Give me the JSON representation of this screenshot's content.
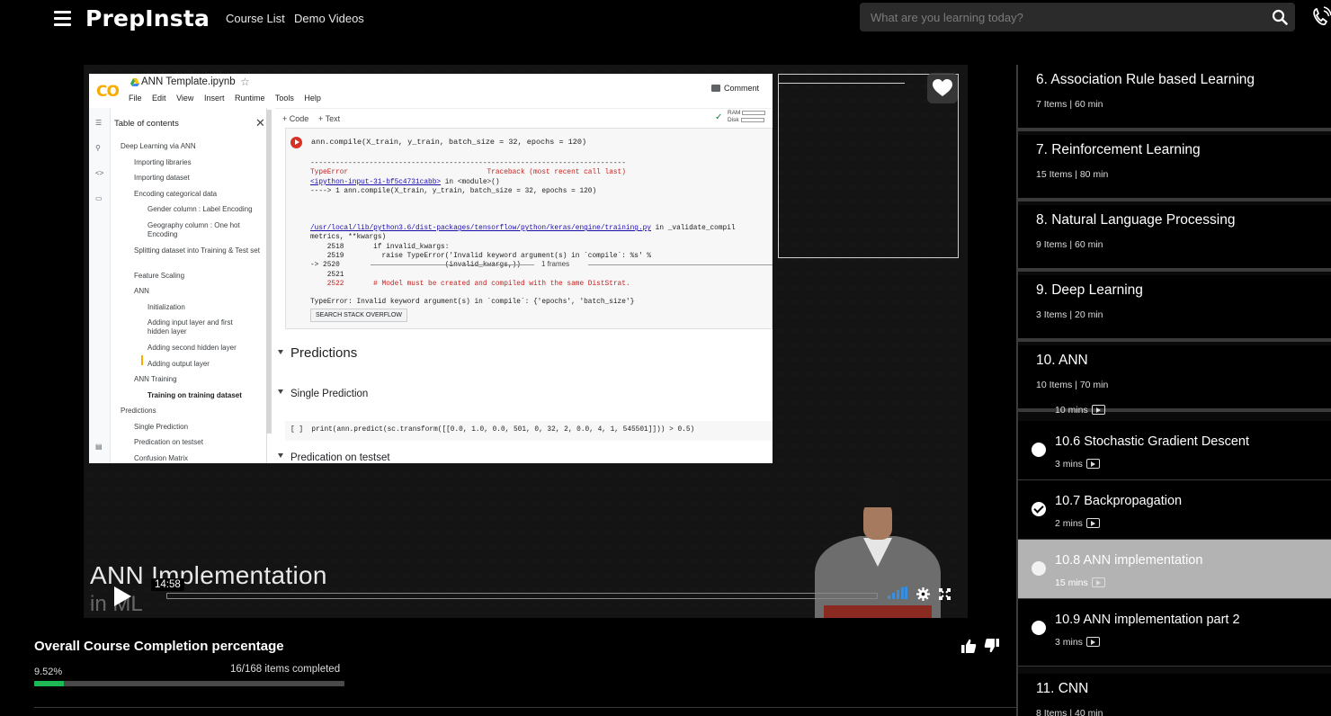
{
  "nav": {
    "logo": "PrepInsta",
    "links": [
      "Course List",
      "Demo Videos"
    ],
    "search_placeholder": "What are you learning today?"
  },
  "video": {
    "colab": {
      "logo": "CO",
      "title": "ANN Template.ipynb",
      "menu": [
        "File",
        "Edit",
        "View",
        "Insert",
        "Runtime",
        "Tools",
        "Help"
      ],
      "comment": "Comment",
      "toolbar": [
        "+ Code",
        "+ Text"
      ],
      "ram": "RAM",
      "disk": "Disk",
      "toc_title": "Table of contents",
      "toc": [
        "Deep Learning via ANN",
        "Importing libraries",
        "Importing dataset",
        "Encoding categorical data",
        "Gender column : Label Encoding",
        "Geography column : One hot Encoding",
        "Splitting dataset into Training & Test set",
        "Feature Scaling",
        "ANN",
        "Initialization",
        "Adding input layer and first hidden layer",
        "Adding second hidden layer",
        "Adding output layer",
        "ANN Training",
        "Training on training dataset",
        "Predictions",
        "Single Prediction",
        "Predication on testset",
        "Confusion Matrix"
      ],
      "code": "ann.compile(X_train, y_train, batch_size = 32, epochs = 120)",
      "output": {
        "rule": "---------------------------------------------------------------------------",
        "error_head": "TypeError                                 Traceback (most recent call last)",
        "input_link": "<ipython-input-31-bf5c4731cabb>",
        "in_module": " in <module>()",
        "arrow_line": "----> 1 ann.compile(X_train, y_train, batch_size = 32, epochs = 120)",
        "frames": "1 frames",
        "path_link": "/usr/local/lib/python3.6/dist-packages/tensorflow/python/keras/engine/training.py",
        "path_tail": " in _validate_compil",
        "metrics": "metrics, **kwargs)",
        "l2518": "    2518       if invalid_kwargs:",
        "l2519": "    2519         raise TypeError('Invalid keyword argument(s) in `compile`: %s' %",
        "l2520": "-> 2520                         (invalid_kwargs,))",
        "l2521": "    2521",
        "l2522": "    2522       # Model must be created and compiled with the same DistStrat.",
        "final_error": "TypeError: Invalid keyword argument(s) in `compile`: {'epochs', 'batch_size'}"
      },
      "so_button": "SEARCH STACK OVERFLOW",
      "sections": [
        "Predictions",
        "Single Prediction",
        "Predication on testset"
      ],
      "predict_prompt": "[ ]",
      "predict_code": "print(ann.predict(sc.transform([[0.0, 1.0, 0.0, 501, 0, 32, 2, 0.0, 4, 1, 545501]])) > 0.5)"
    },
    "overlay_title": "ANN Implementation",
    "overlay_subtitle": "in ML",
    "time": "14:58",
    "progress": 0.0
  },
  "completion": {
    "title": "Overall Course Completion percentage",
    "percent_label": "9.52%",
    "percent": 9.52,
    "items_completed": "16/168 items completed"
  },
  "sidebar": {
    "sections": [
      {
        "title": "6. Association Rule based Learning",
        "meta": "7 Items | 60 min"
      },
      {
        "title": "7. Reinforcement Learning",
        "meta": "15 Items | 80 min"
      },
      {
        "title": "8. Natural Language Processing",
        "meta": "9 Items | 60 min"
      },
      {
        "title": "9. Deep Learning",
        "meta": "3 Items | 20 min"
      },
      {
        "title": "10. ANN",
        "meta": "10 Items | 70 min"
      }
    ],
    "partial_meta": "10 mins",
    "lessons": [
      {
        "title": "10.6 Stochastic Gradient Descent",
        "meta": "3 mins",
        "completed": false,
        "active": false
      },
      {
        "title": "10.7 Backpropagation",
        "meta": "2 mins",
        "completed": true,
        "active": false
      },
      {
        "title": "10.8 ANN implementation",
        "meta": "15 mins",
        "completed": false,
        "active": true
      },
      {
        "title": "10.9 ANN implementation part 2",
        "meta": "3 mins",
        "completed": false,
        "active": false
      }
    ],
    "next_section": {
      "title": "11. CNN",
      "meta": "8 Items | 40 min"
    }
  }
}
